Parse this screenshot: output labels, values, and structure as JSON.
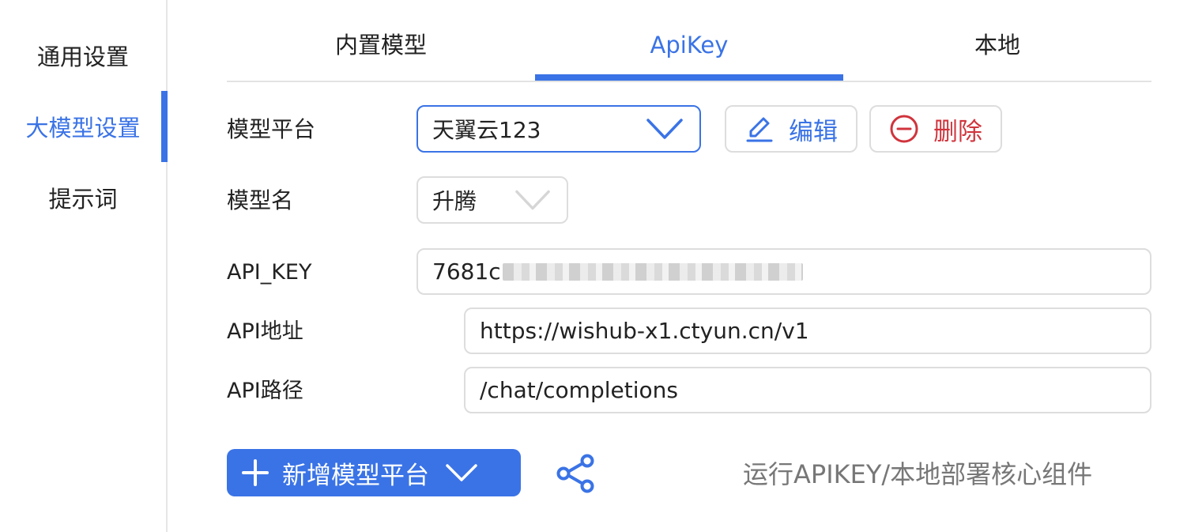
{
  "sidebar": {
    "items": [
      {
        "label": "通用设置"
      },
      {
        "label": "大模型设置"
      },
      {
        "label": "提示词"
      }
    ]
  },
  "tabs": [
    {
      "label": "内置模型"
    },
    {
      "label": "ApiKey"
    },
    {
      "label": "本地"
    }
  ],
  "form": {
    "platform_label": "模型平台",
    "platform_value": "天翼云123",
    "edit_label": "编辑",
    "delete_label": "删除",
    "model_label": "模型名",
    "model_value": "升腾",
    "apikey_label": "API_KEY",
    "apikey_visible": "7681c",
    "address_label": "API地址",
    "address_value": "https://wishub-x1.ctyun.cn/v1",
    "path_label": "API路径",
    "path_value": "/chat/completions"
  },
  "actions": {
    "add_platform_label": "新增模型平台",
    "core_component_text": "运行APIKEY/本地部署核心组件"
  },
  "colors": {
    "accent": "#3a73e6",
    "danger": "#d0343d",
    "muted_text": "#777777",
    "border": "#dddddd"
  },
  "icons": {
    "edit": "pencil-icon",
    "delete": "minus-circle-icon",
    "dropdown": "chevron-down-icon",
    "add": "plus-icon",
    "share": "share-icon"
  }
}
